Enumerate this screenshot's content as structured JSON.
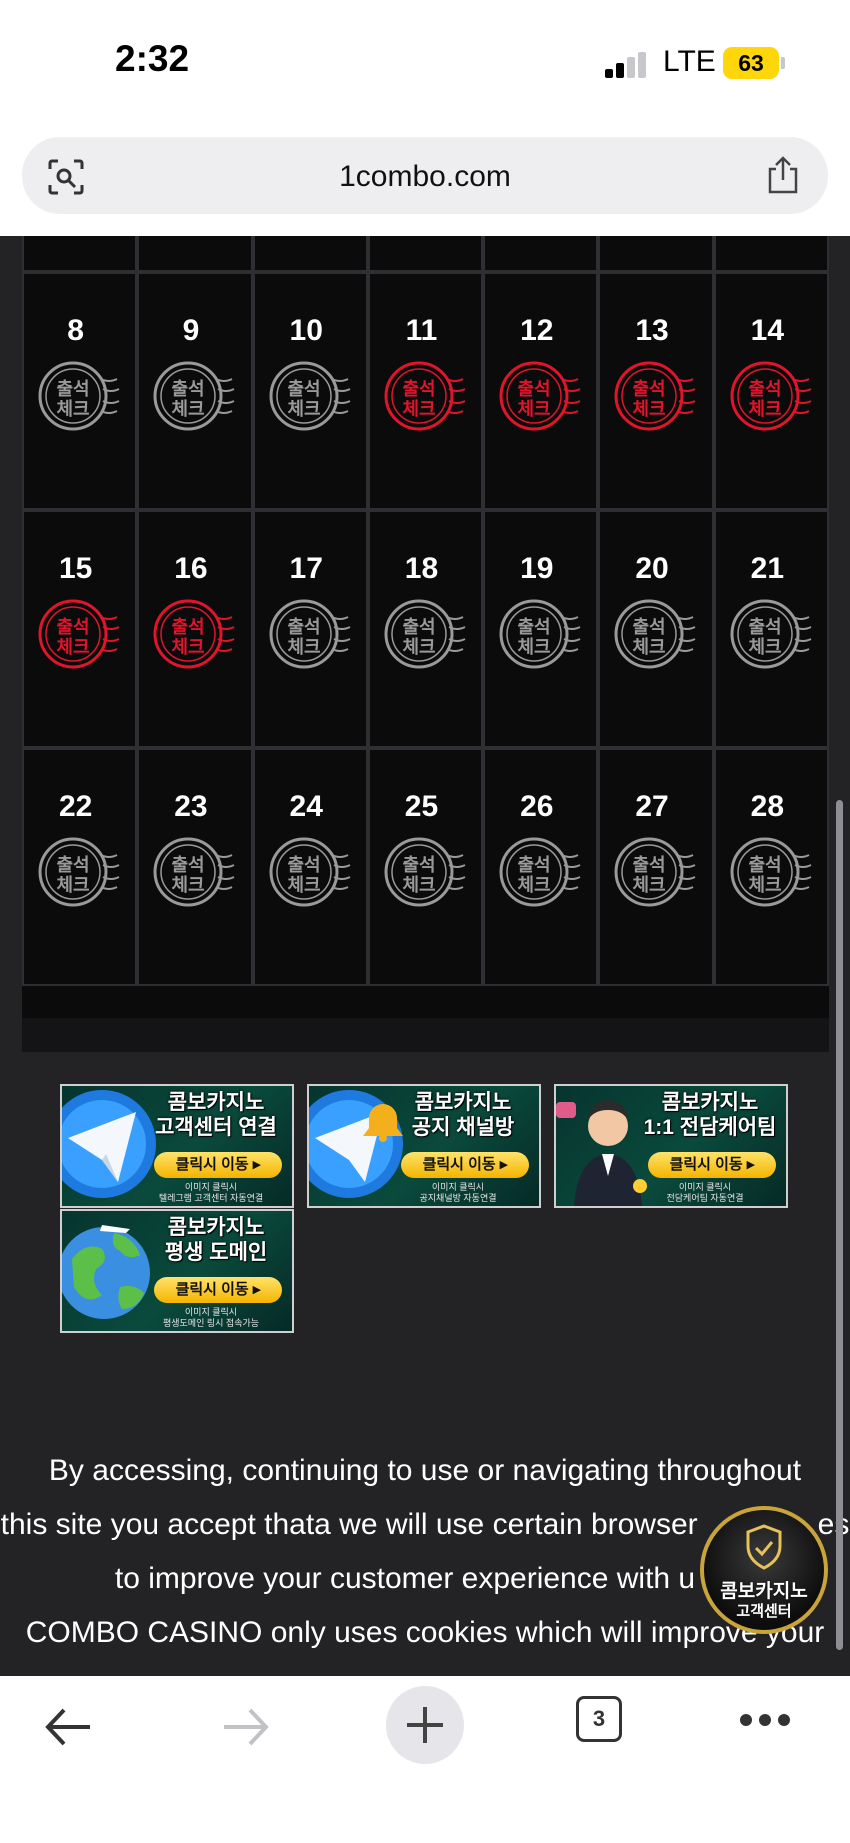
{
  "status_bar": {
    "time": "2:32",
    "network": "LTE",
    "battery": "63"
  },
  "browser": {
    "url": "1combo.com",
    "tab_count": "3"
  },
  "calendar": {
    "weeks": [
      [
        {
          "day": "8",
          "checked": false
        },
        {
          "day": "9",
          "checked": false
        },
        {
          "day": "10",
          "checked": false
        },
        {
          "day": "11",
          "checked": true
        },
        {
          "day": "12",
          "checked": true
        },
        {
          "day": "13",
          "checked": true
        },
        {
          "day": "14",
          "checked": true
        }
      ],
      [
        {
          "day": "15",
          "checked": true
        },
        {
          "day": "16",
          "checked": true
        },
        {
          "day": "17",
          "checked": false
        },
        {
          "day": "18",
          "checked": false
        },
        {
          "day": "19",
          "checked": false
        },
        {
          "day": "20",
          "checked": false
        },
        {
          "day": "21",
          "checked": false
        }
      ],
      [
        {
          "day": "22",
          "checked": false
        },
        {
          "day": "23",
          "checked": false
        },
        {
          "day": "24",
          "checked": false
        },
        {
          "day": "25",
          "checked": false
        },
        {
          "day": "26",
          "checked": false
        },
        {
          "day": "27",
          "checked": false
        },
        {
          "day": "28",
          "checked": false
        }
      ]
    ],
    "stamp_text_top": "출석",
    "stamp_text_bottom": "체크",
    "checked_color": "#e0142b",
    "unchecked_color": "#9a9a9a"
  },
  "banners": [
    {
      "title_1": "콤보카지노",
      "title_2": "고객센터 연결",
      "button": "클릭시 이동",
      "small_1": "이미지 클릭시",
      "small_2": "텔레그램 고객센터 자동연결",
      "icon": "telegram-icon"
    },
    {
      "title_1": "콤보카지노",
      "title_2": "공지 채널방",
      "button": "클릭시 이동",
      "small_1": "이미지 클릭시",
      "small_2": "공지채널방 자동연결",
      "icon": "telegram-bell-icon"
    },
    {
      "title_1": "콤보카지노",
      "title_2": "1:1 전담케어팀",
      "button": "클릭시 이동",
      "small_1": "이미지 클릭시",
      "small_2": "전담케어팀 자동연결",
      "icon": "agent-avatar-icon"
    },
    {
      "title_1": "콤보카지노",
      "title_2": "평생 도메인",
      "button": "클릭시 이동",
      "small_1": "이미지 클릭시",
      "small_2": "평생도메인 링시 접속가능",
      "icon": "globe-icon"
    }
  ],
  "notice": {
    "line_1": "By accessing, continuing to use or navigating throughout",
    "line_2": "this site you accept thata we will use certain browser",
    "line_2_tail": "es",
    "line_3": "to improve your customer experience with u",
    "line_4": "COMBO CASINO only uses cookies which will improve your"
  },
  "support_badge": {
    "line_1": "콤보카지노",
    "line_2": "고객센터"
  }
}
